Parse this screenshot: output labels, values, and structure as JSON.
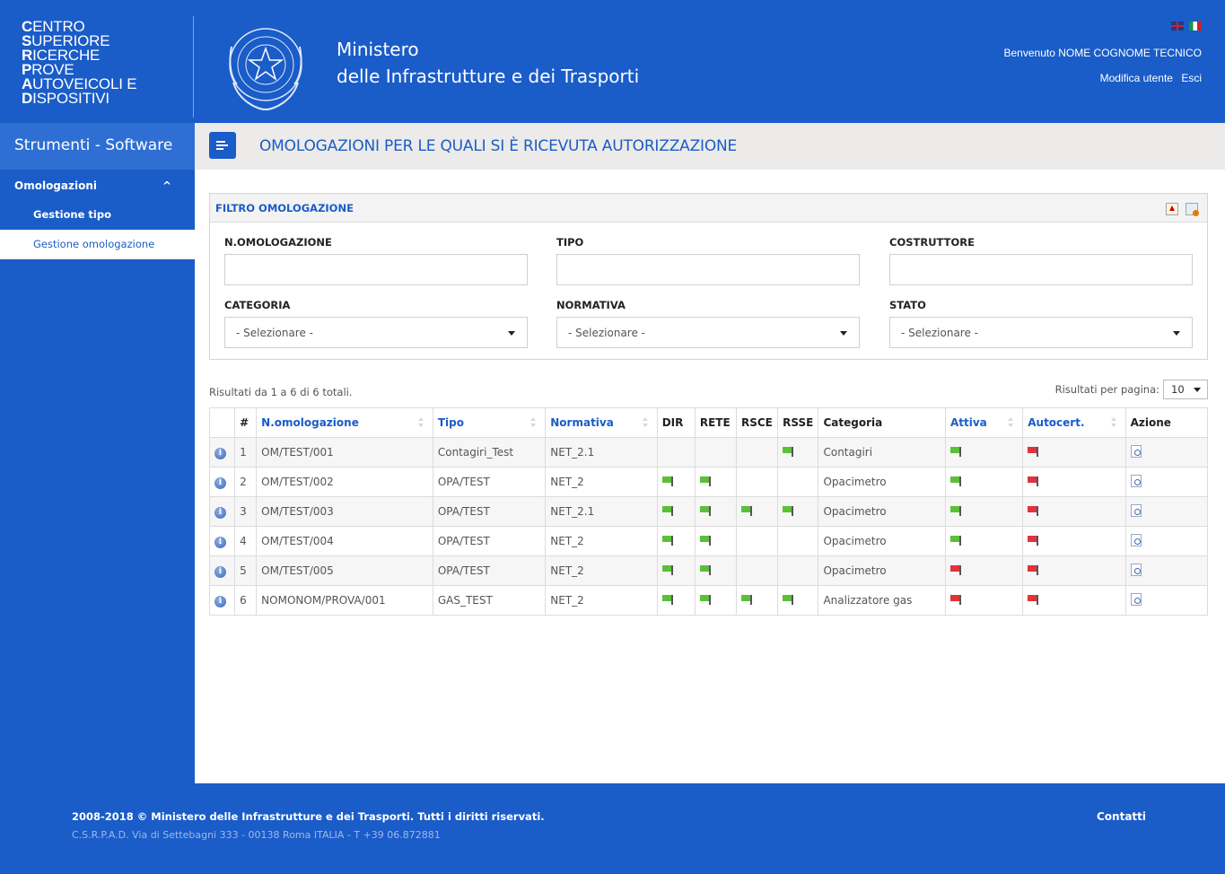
{
  "header": {
    "logo_lines": [
      {
        "initial": "C",
        "rest": "ENTRO"
      },
      {
        "initial": "S",
        "rest": "UPERIORE"
      },
      {
        "initial": "R",
        "rest": "ICERCHE"
      },
      {
        "initial": "P",
        "rest": "ROVE"
      },
      {
        "initial": "A",
        "rest": "UTOVEICOLI E"
      },
      {
        "initial": "D",
        "rest": "ISPOSITIVI"
      }
    ],
    "ministry_line1": "Ministero",
    "ministry_line2": "delle Infrastrutture e dei Trasporti",
    "welcome": "Benvenuto NOME COGNOME TECNICO",
    "edit_user": "Modifica utente",
    "logout": "Esci"
  },
  "sidebar": {
    "title": "Strumenti - Software",
    "section": "Omologazioni",
    "items": [
      {
        "label": "Gestione tipo"
      },
      {
        "label": "Gestione omologazione"
      }
    ]
  },
  "page": {
    "title": "OMOLOGAZIONI PER LE QUALI SI È RICEVUTA AUTORIZZAZIONE"
  },
  "filter": {
    "title": "FILTRO OMOLOGAZIONE",
    "labels": {
      "n_omologazione": "N.OMOLOGAZIONE",
      "tipo": "TIPO",
      "costruttore": "COSTRUTTORE",
      "categoria": "CATEGORIA",
      "normativa": "NORMATIVA",
      "stato": "STATO"
    },
    "select_placeholder": "- Selezionare -"
  },
  "results": {
    "info": "Risultati da 1 a 6 di 6 totali.",
    "per_page_label": "Risultati per pagina:",
    "per_page_value": "10"
  },
  "table": {
    "headers": {
      "num": "#",
      "n_omologazione": "N.omologazione",
      "tipo": "Tipo",
      "normativa": "Normativa",
      "dir": "DIR",
      "rete": "RETE",
      "rsce": "RSCE",
      "rsse": "RSSE",
      "categoria": "Categoria",
      "attiva": "Attiva",
      "autocert": "Autocert.",
      "azione": "Azione"
    },
    "rows": [
      {
        "num": "1",
        "n_omologazione": "OM/TEST/001",
        "tipo": "Contagiri_Test",
        "normativa": "NET_2.1",
        "dir": null,
        "rete": null,
        "rsce": null,
        "rsse": "green",
        "categoria": "Contagiri",
        "attiva": "green",
        "autocert": "red"
      },
      {
        "num": "2",
        "n_omologazione": "OM/TEST/002",
        "tipo": "OPA/TEST",
        "normativa": "NET_2",
        "dir": "green",
        "rete": "green",
        "rsce": null,
        "rsse": null,
        "categoria": "Opacimetro",
        "attiva": "green",
        "autocert": "red"
      },
      {
        "num": "3",
        "n_omologazione": "OM/TEST/003",
        "tipo": "OPA/TEST",
        "normativa": "NET_2.1",
        "dir": "green",
        "rete": "green",
        "rsce": "green",
        "rsse": "green",
        "categoria": "Opacimetro",
        "attiva": "green",
        "autocert": "red"
      },
      {
        "num": "4",
        "n_omologazione": "OM/TEST/004",
        "tipo": "OPA/TEST",
        "normativa": "NET_2",
        "dir": "green",
        "rete": "green",
        "rsce": null,
        "rsse": null,
        "categoria": "Opacimetro",
        "attiva": "green",
        "autocert": "red"
      },
      {
        "num": "5",
        "n_omologazione": "OM/TEST/005",
        "tipo": "OPA/TEST",
        "normativa": "NET_2",
        "dir": "green",
        "rete": "green",
        "rsce": null,
        "rsse": null,
        "categoria": "Opacimetro",
        "attiva": "red",
        "autocert": "red"
      },
      {
        "num": "6",
        "n_omologazione": "NOMONOM/PROVA/001",
        "tipo": "GAS_TEST",
        "normativa": "NET_2",
        "dir": "green",
        "rete": "green",
        "rsce": "green",
        "rsse": "green",
        "categoria": "Analizzatore gas",
        "attiva": "red",
        "autocert": "red"
      }
    ]
  },
  "footer": {
    "copyright": "2008-2018 © Ministero delle Infrastrutture e dei Trasporti. Tutti i diritti riservati.",
    "address": "C.S.R.P.A.D. Via di Settebagni 333 - 00138 Roma ITALIA - T +39 06.872881",
    "contacts": "Contatti"
  },
  "colors": {
    "brand_blue": "#1a5cc8",
    "flag_green": "#5cbf3a",
    "flag_red": "#e0333b"
  }
}
